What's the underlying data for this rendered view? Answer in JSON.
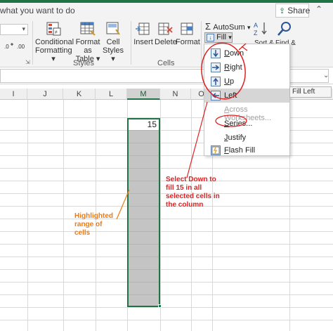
{
  "titlebar": {
    "tell_me": "what you want to do",
    "share_label": "Share"
  },
  "ribbon": {
    "styles": {
      "conditional_formatting": [
        "Conditional",
        "Formatting ▾"
      ],
      "format_as_table": [
        "Format as",
        "Table ▾"
      ],
      "cell_styles": [
        "Cell",
        "Styles ▾"
      ],
      "group_label": "Styles"
    },
    "cells": {
      "insert": "Insert",
      "delete": "Delete",
      "format": "Format",
      "group_label": "Cells"
    },
    "editing": {
      "autosum": "AutoSum",
      "fill": "Fill",
      "sort_partial": "Sort &",
      "find_partial": "Find &"
    }
  },
  "columns": [
    "I",
    "J",
    "K",
    "L",
    "M",
    "N",
    "O"
  ],
  "active_cell_value": "15",
  "fill_menu": {
    "items": [
      {
        "label": "Down",
        "icon": "fill-down-icon"
      },
      {
        "label": "Right",
        "icon": "fill-right-icon"
      },
      {
        "label": "Up",
        "icon": "fill-up-icon"
      },
      {
        "label": "Left",
        "icon": "fill-left-icon"
      },
      {
        "label": "Across Worksheets...",
        "disabled": true
      },
      {
        "label": "Series..."
      },
      {
        "label": "Justify"
      },
      {
        "label": "Flash Fill",
        "icon": "flash-fill-icon"
      }
    ],
    "tooltip": "Fill Left"
  },
  "annotations": {
    "red": "Select Down to fill 15 in all selected cells in the column",
    "orange": "Highlighted range of cells"
  },
  "colors": {
    "excel_green": "#217346",
    "annotation_red": "#e02020",
    "annotation_orange": "#f07a10",
    "selection_gray": "#c4c4c4"
  }
}
